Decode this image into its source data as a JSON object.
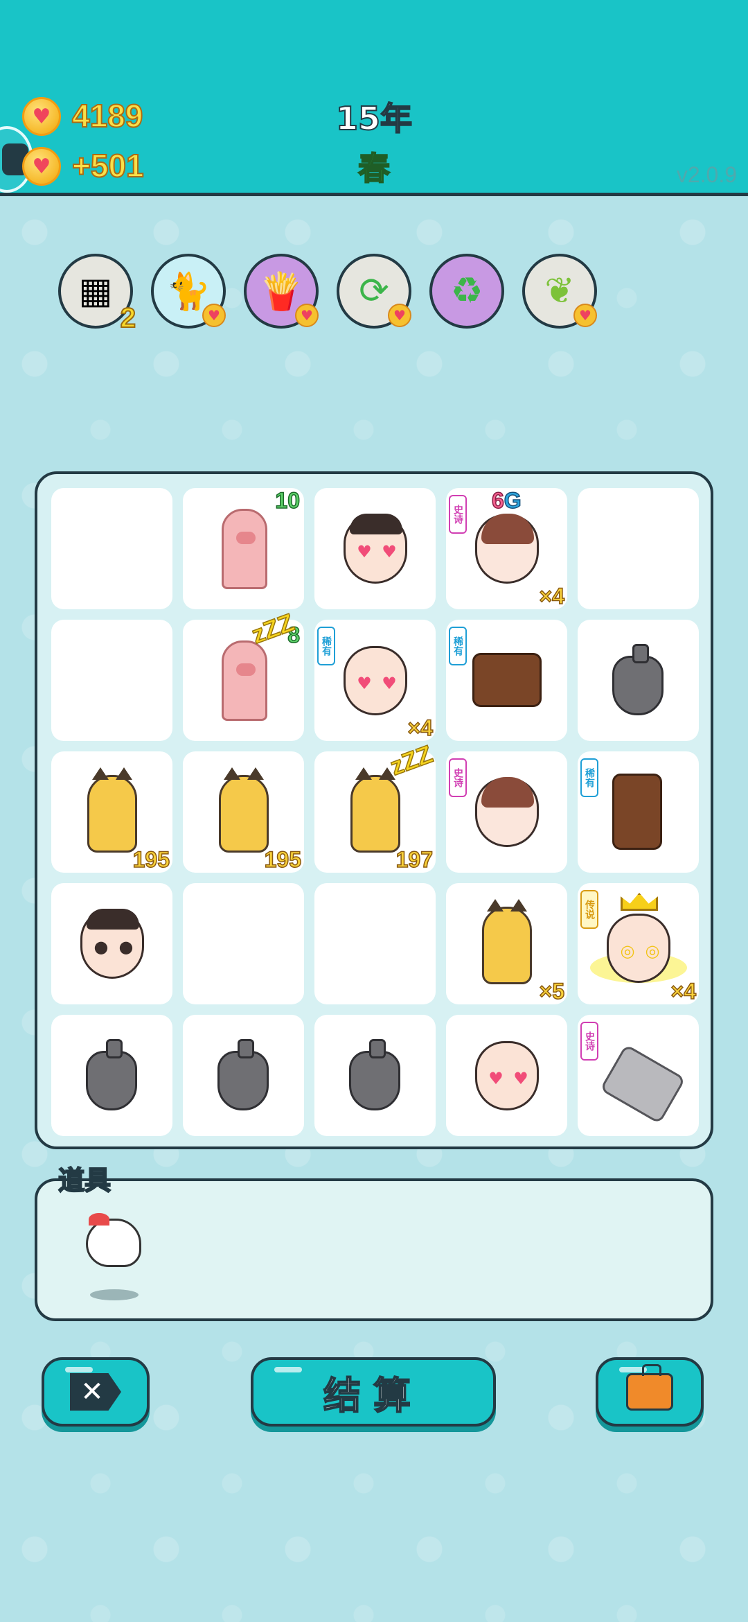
{
  "header": {
    "coins": "4189",
    "income": "+501",
    "year": "15年",
    "season": "春",
    "version": "v2.0.9"
  },
  "buffs": [
    {
      "name": "egg-tray-icon",
      "glyph": "▦",
      "bg": "#e6e6df",
      "count": "2"
    },
    {
      "name": "cat-buff-icon",
      "glyph": "🐈",
      "bg": "#c9f0f6"
    },
    {
      "name": "fries-icon",
      "glyph": "🍟",
      "bg": "#c899e3"
    },
    {
      "name": "refresh-icon",
      "glyph": "🔄",
      "bg": "#e6e6df"
    },
    {
      "name": "recycle-icon",
      "glyph": "♻",
      "bg": "#c899e3"
    },
    {
      "name": "leaf-icon",
      "glyph": "🍃",
      "bg": "#e6e6df"
    }
  ],
  "board": {
    "r1": {
      "pig_top": "10",
      "girl_top_a": "6",
      "girl_top_b": "G",
      "girl_mult": "×4",
      "girl_tag": "史诗"
    },
    "r2": {
      "pig_top": "8",
      "pig_zzz": "zZZ",
      "bald_tag": "稀有",
      "bald_mult": "×4",
      "hand_tag": "稀有"
    },
    "r3": {
      "cat1": "195",
      "cat2": "195",
      "cat3": "197",
      "cat3_zzz": "zZZ",
      "girl_tag": "史诗",
      "hand_tag": "稀有"
    },
    "r4": {
      "cat_mult": "×5",
      "king_tag": "传说",
      "king_mult": "×4"
    },
    "r5": {
      "hand_tag": "史诗"
    }
  },
  "items": {
    "label": "道具"
  },
  "buttons": {
    "close": "✕",
    "settle": "结算"
  },
  "colors": {
    "header_bg": "#19c4c7",
    "body_bg": "#b4e2e8",
    "epic": "#d13fb3",
    "rare": "#1f9fd6",
    "legend": "#d89b12"
  }
}
